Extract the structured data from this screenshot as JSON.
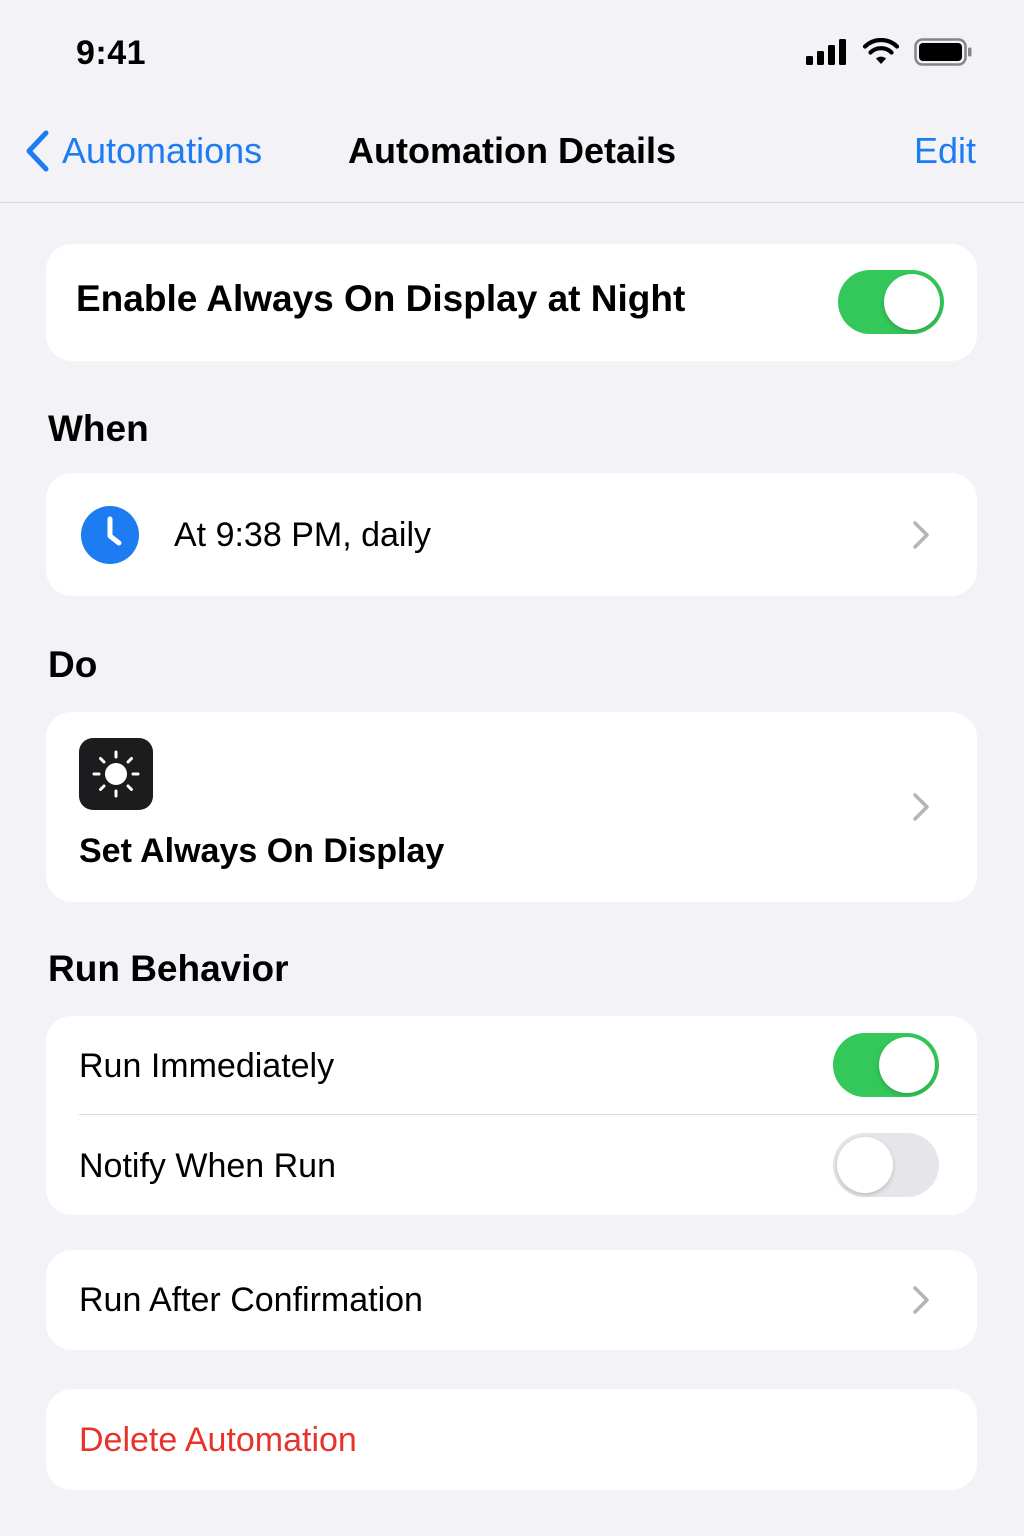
{
  "status_bar": {
    "time": "9:41",
    "icons": [
      "cellular-signal-icon",
      "wifi-icon",
      "battery-icon"
    ]
  },
  "nav": {
    "back_label": "Automations",
    "title": "Automation Details",
    "edit_label": "Edit"
  },
  "automation": {
    "name": "Enable Always On Display at Night",
    "enabled": true
  },
  "when": {
    "header": "When",
    "trigger": "At 9:38 PM, daily",
    "icon": "clock-icon"
  },
  "do": {
    "header": "Do",
    "action": "Set Always On Display",
    "icon": "sun-icon"
  },
  "run_behavior": {
    "header": "Run Behavior",
    "run_immediately_label": "Run Immediately",
    "run_immediately": true,
    "notify_label": "Notify When Run",
    "notify": false,
    "confirmation_label": "Run After Confirmation"
  },
  "delete_label": "Delete Automation",
  "colors": {
    "accent": "#1e7cf2",
    "toggle_on": "#34c759",
    "destructive": "#e8332b",
    "background": "#f2f2f7"
  }
}
